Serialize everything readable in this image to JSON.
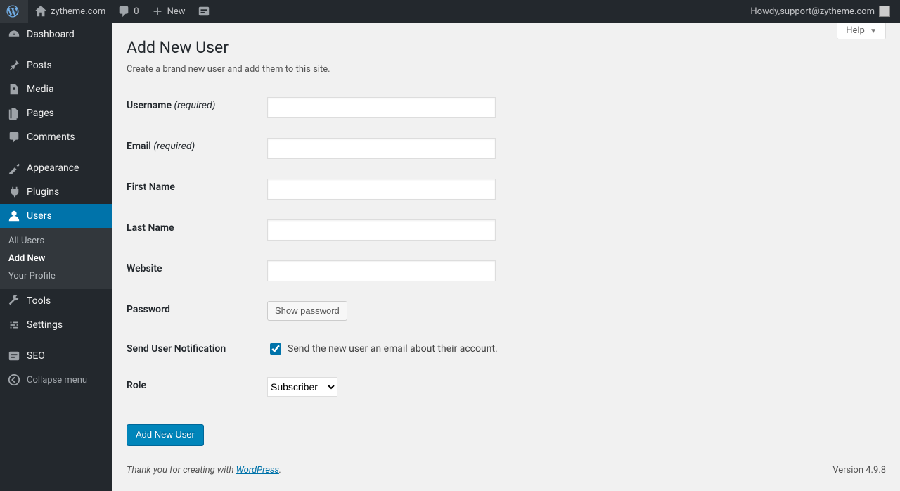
{
  "adminbar": {
    "site_name": "zytheme.com",
    "comments_count": "0",
    "new_label": "New",
    "howdy_prefix": "Howdy, ",
    "user_name": "support@zytheme.com"
  },
  "sidebar": {
    "dashboard": "Dashboard",
    "posts": "Posts",
    "media": "Media",
    "pages": "Pages",
    "comments": "Comments",
    "appearance": "Appearance",
    "plugins": "Plugins",
    "users": "Users",
    "tools": "Tools",
    "settings": "Settings",
    "seo": "SEO",
    "collapse": "Collapse menu",
    "submenu": {
      "all_users": "All Users",
      "add_new": "Add New",
      "your_profile": "Your Profile"
    }
  },
  "page": {
    "help_label": "Help",
    "title": "Add New User",
    "description": "Create a brand new user and add them to this site.",
    "submit_label": "Add New User"
  },
  "form": {
    "username_label": "Username",
    "email_label": "Email",
    "required_suffix": "(required)",
    "first_name_label": "First Name",
    "last_name_label": "Last Name",
    "website_label": "Website",
    "password_label": "Password",
    "show_password_button": "Show password",
    "notification_label": "Send User Notification",
    "notification_checkbox_text": "Send the new user an email about their account.",
    "role_label": "Role",
    "role_selected": "Subscriber"
  },
  "footer": {
    "thanks_prefix": "Thank you for creating with ",
    "wp_link_text": "WordPress",
    "thanks_suffix": ".",
    "version": "Version 4.9.8"
  }
}
